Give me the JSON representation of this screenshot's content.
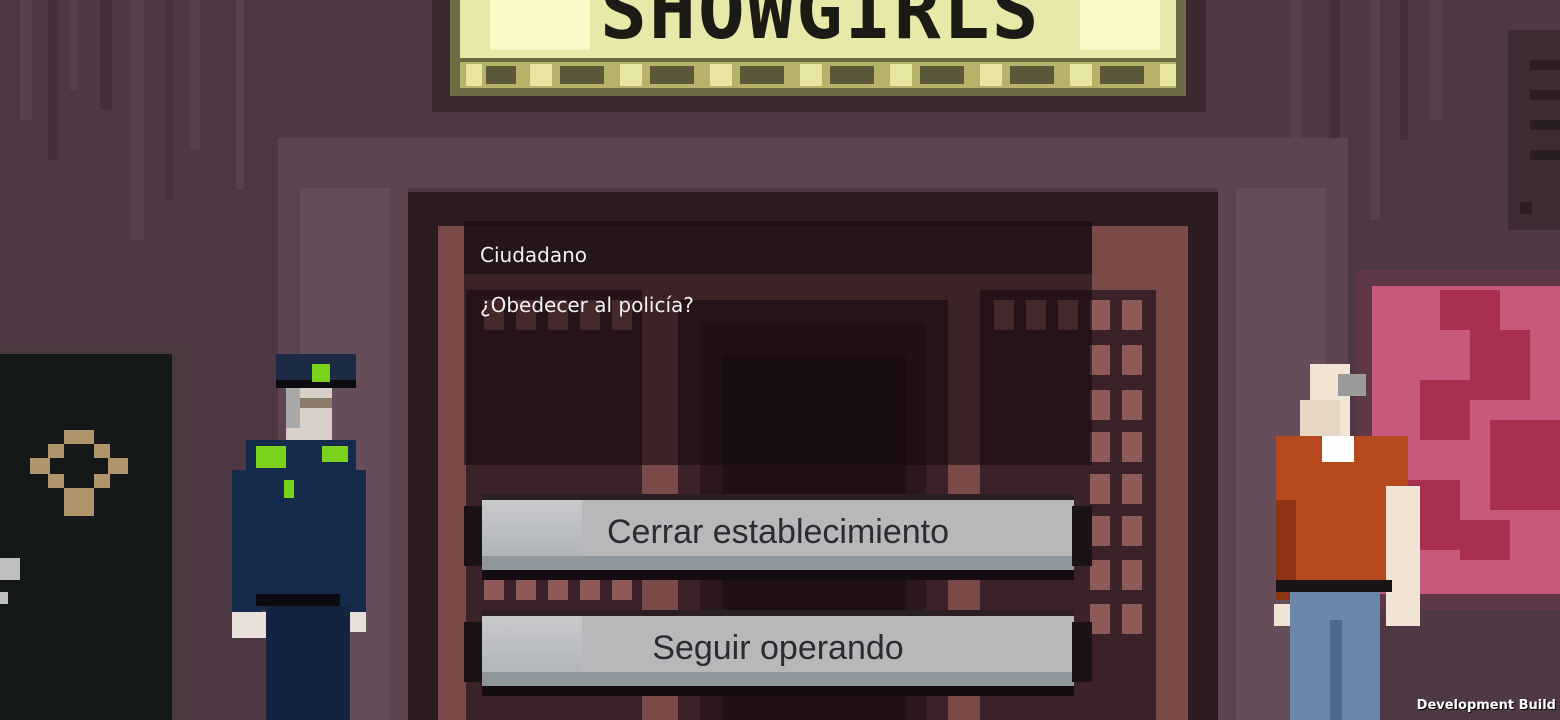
{
  "sign": {
    "text": "SHOWGIRLS"
  },
  "dialog": {
    "speaker": "Ciudadano",
    "question": "¿Obedecer al policía?"
  },
  "choices": [
    {
      "label": "Cerrar establecimiento"
    },
    {
      "label": "Seguir operando"
    }
  ],
  "watermark": "Development Build",
  "colors": {
    "wall": "#4a3640",
    "door_frame": "#2b1c22",
    "button_face": "#b8b8ba",
    "button_text": "#2c2c30",
    "police_uniform": "#162a4c",
    "police_badge": "#7ad21a",
    "citizen_shirt": "#b64a1e"
  }
}
